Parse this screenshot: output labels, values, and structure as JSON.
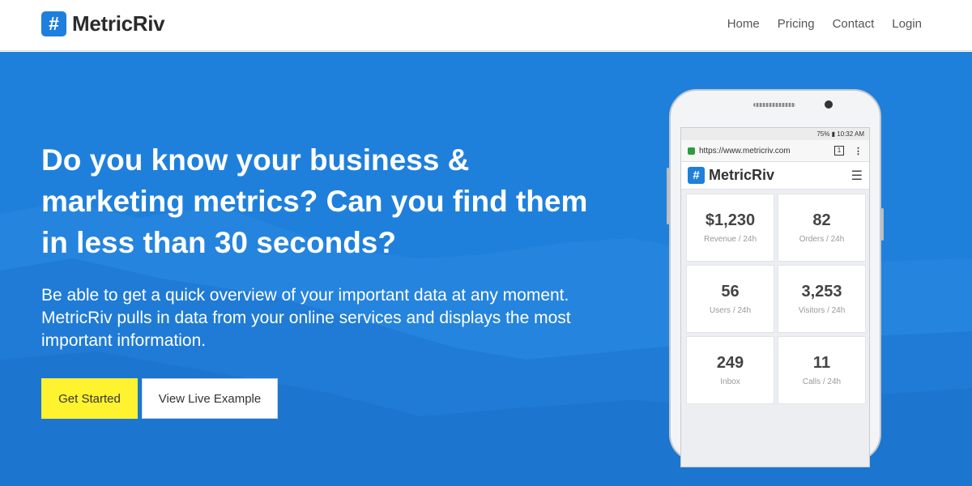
{
  "brand": {
    "icon": "#",
    "name": "MetricRiv"
  },
  "nav": {
    "items": [
      "Home",
      "Pricing",
      "Contact",
      "Login"
    ]
  },
  "hero": {
    "headline_lines": [
      "Do you know your business &",
      "marketing metrics? Can you find them",
      "in less than 30 seconds?"
    ],
    "sub_lines": [
      "Be able to get a quick overview of your important data at any moment.",
      "MetricRiv pulls in data from your online services and displays the most",
      "important information."
    ],
    "get_started": "Get Started",
    "live_example": "View Live Example"
  },
  "phone": {
    "status": "75% ▮ 10:32 AM",
    "url": "https://www.metricriv.com",
    "tabs": "1",
    "app_icon": "#",
    "app_name": "MetricRiv",
    "cards": [
      {
        "value": "$1,230",
        "label": "Revenue / 24h"
      },
      {
        "value": "82",
        "label": "Orders / 24h"
      },
      {
        "value": "56",
        "label": "Users / 24h"
      },
      {
        "value": "3,253",
        "label": "Visitors / 24h"
      },
      {
        "value": "249",
        "label": "Inbox"
      },
      {
        "value": "11",
        "label": "Calls / 24h"
      }
    ]
  },
  "colors": {
    "accent": "#1f80dc",
    "cta": "#fff22e"
  }
}
